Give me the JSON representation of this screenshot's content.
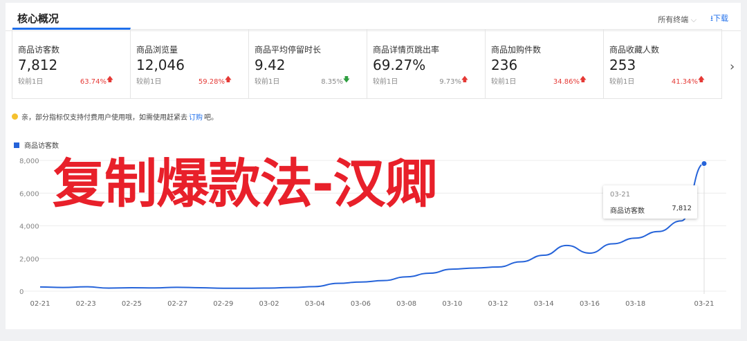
{
  "header": {
    "title": "核心概况",
    "terminal_select": "所有终端",
    "download": "下载"
  },
  "cards": [
    {
      "label": "商品访客数",
      "value": "7,812",
      "compare": "较前1日",
      "change": "63.74%",
      "dir": "up"
    },
    {
      "label": "商品浏览量",
      "value": "12,046",
      "compare": "较前1日",
      "change": "59.28%",
      "dir": "up"
    },
    {
      "label": "商品平均停留时长",
      "value": "9.42",
      "compare": "较前1日",
      "change": "8.35%",
      "dir": "down"
    },
    {
      "label": "商品详情页跳出率",
      "value": "69.27%",
      "compare": "较前1日",
      "change": "9.73%",
      "dir": "up"
    },
    {
      "label": "商品加购件数",
      "value": "236",
      "compare": "较前1日",
      "change": "34.86%",
      "dir": "up"
    },
    {
      "label": "商品收藏人数",
      "value": "253",
      "compare": "较前1日",
      "change": "41.34%",
      "dir": "up"
    }
  ],
  "notice": {
    "before": "亲，部分指标仅支持付费用户使用哦，如需使用赶紧去",
    "link": "订购",
    "after": "吧。"
  },
  "overlay_text": "复制爆款法-汉卿",
  "tooltip": {
    "date": "03-21",
    "name": "商品访客数",
    "value": "7,812"
  },
  "colors": {
    "accent": "#1f6feb",
    "line": "#2563d9",
    "up": "#e53935",
    "down": "#2e9e3f",
    "overlay": "#e8202a"
  },
  "chart_data": {
    "type": "line",
    "series": [
      {
        "name": "商品访客数",
        "x": [
          "02-21",
          "02-22",
          "02-23",
          "02-24",
          "02-25",
          "02-26",
          "02-27",
          "02-28",
          "02-29",
          "03-01",
          "03-02",
          "03-03",
          "03-04",
          "03-05",
          "03-06",
          "03-07",
          "03-08",
          "03-09",
          "03-10",
          "03-11",
          "03-12",
          "03-13",
          "03-14",
          "03-15",
          "03-16",
          "03-17",
          "03-18",
          "03-19",
          "03-20",
          "03-21"
        ],
        "values": [
          260,
          230,
          270,
          190,
          210,
          200,
          240,
          210,
          180,
          180,
          190,
          230,
          280,
          480,
          560,
          650,
          880,
          1100,
          1350,
          1420,
          1480,
          1800,
          2200,
          2800,
          2330,
          2900,
          3250,
          3650,
          4300,
          7812
        ]
      }
    ],
    "xticks": [
      "02-21",
      "02-23",
      "02-25",
      "02-27",
      "02-29",
      "03-02",
      "03-04",
      "03-06",
      "03-08",
      "03-10",
      "03-12",
      "03-14",
      "03-16",
      "03-18",
      "03-21"
    ],
    "yticks": [
      "0",
      "2,000",
      "4,000",
      "6,000",
      "8,000"
    ],
    "ylim": [
      0,
      8000
    ],
    "grid": true
  }
}
